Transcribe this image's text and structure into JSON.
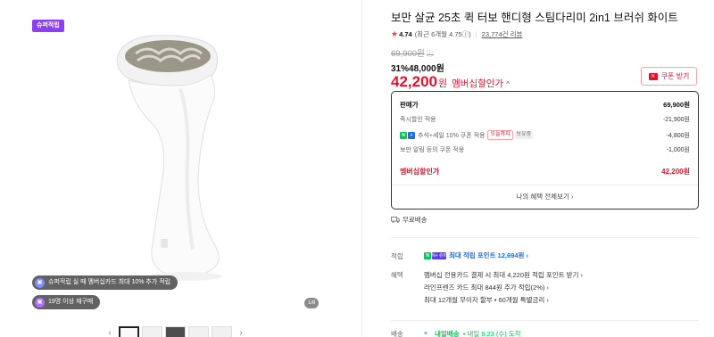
{
  "gallery": {
    "badge": "슈퍼적립",
    "pill_1": "슈퍼적립 실 때 멤버십카드 최대 10% 추가 적립",
    "pill_2": "19명 이상 재구매",
    "page_counter": "1/8",
    "thumb_prev": "‹",
    "thumb_next": "›"
  },
  "product": {
    "title": "보만 살균 25초 퀵 터보 핸디형 스팀다리미 2in1 브러쉬 화이트",
    "rating": "4.74",
    "rating_recent": "(최근 6개월 4.75ⓘ)",
    "reviews": "23,774건 리뷰",
    "original_price": "69,900원",
    "original_info": "ⓘ",
    "discount_line": "31%48,000원",
    "member_price": "42,200",
    "member_price_unit": "원",
    "member_price_label": "멤버십할인가",
    "member_price_caret": "^",
    "coupon_button": "쿠폰 받기",
    "coupon_icon": "✕"
  },
  "breakdown": {
    "rows": [
      {
        "label": "판매가",
        "value": "69,900원"
      },
      {
        "label": "즉시할인 적용",
        "value": "-21,900원"
      },
      {
        "label": "추석+세일 10% 쿠폰 적용",
        "tag1": "오늘까지",
        "tag2": "보유중",
        "value": "-4,800원"
      },
      {
        "label": "보만 알림 등의 쿠폰 적용",
        "value": "-1,000원"
      },
      {
        "label": "멤버십할인가",
        "value": "42,200원"
      }
    ],
    "more_link": "나의 혜택 전체보기 ›"
  },
  "shipping_free": "무료배송",
  "points": {
    "label": "적립",
    "badge": "N+ 슈퍼",
    "text": "최대 적립 포인트 12,694원 ›"
  },
  "benefits": {
    "label": "혜택",
    "items": [
      "멤버십 전용카드 결제 시 최대 4,220원 적립 포인트 받기 ›",
      "라인프렌즈 카드 최대 844원 추가 적립(2%) ›",
      "최대 12개월 무이자 할부 • 60개월 특별금리 ›"
    ]
  },
  "delivery": {
    "label": "배송",
    "icon": "+",
    "today": "내일배송",
    "date": "• 내일 9.23 (수) 도착"
  },
  "colors": {
    "accent_red": "#e8112d",
    "naver_green": "#03c75a",
    "super_purple": "#8c3ff0"
  }
}
